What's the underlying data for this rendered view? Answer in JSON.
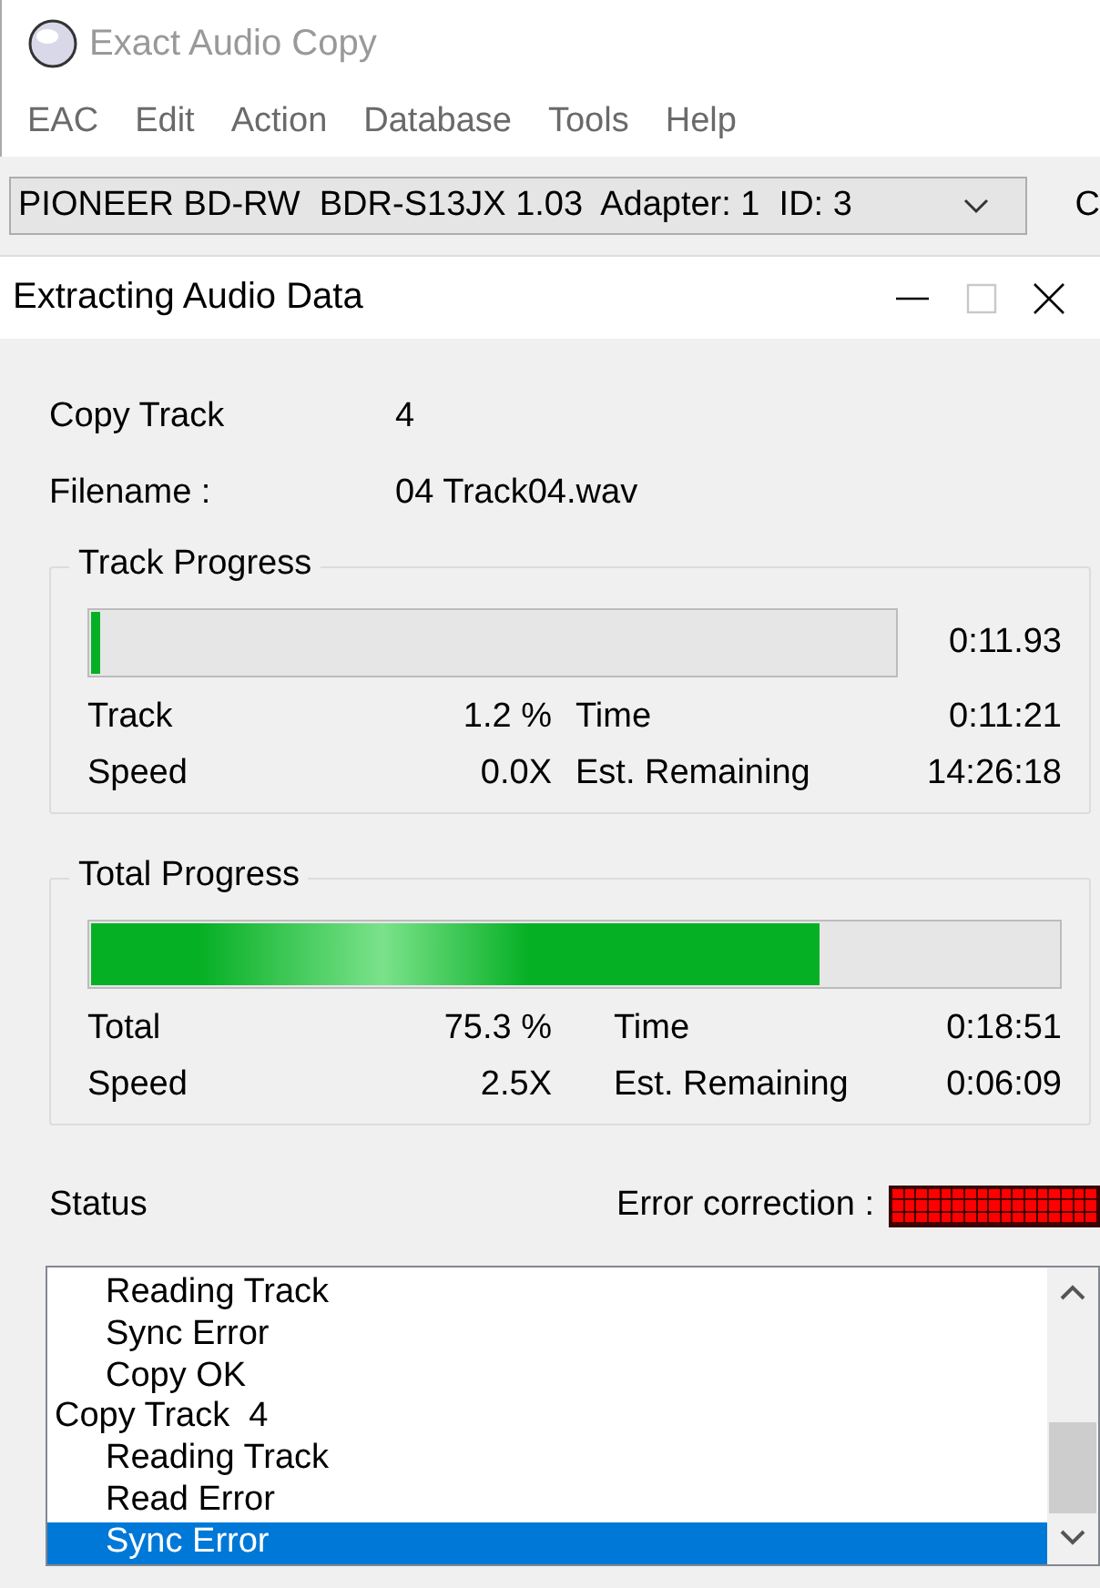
{
  "main_window": {
    "title": "Exact Audio Copy",
    "menu": [
      "EAC",
      "Edit",
      "Action",
      "Database",
      "Tools",
      "Help"
    ],
    "drive": {
      "value": "PIONEER BD-RW  BDR-S13JX 1.03  Adapter: 1  ID: 3"
    },
    "toolbar_cut_text": "C"
  },
  "dialog": {
    "title": "Extracting Audio Data",
    "maximize_disabled": true,
    "fields": [
      {
        "label": "Copy Track",
        "value": "4"
      },
      {
        "label": "Filename :",
        "value": "04 Track04.wav"
      }
    ],
    "groups": [
      {
        "title": "Track Progress",
        "level": 0.012,
        "elapsed": "0:11.93",
        "rows": [
          {
            "label": "Track",
            "value": "1.2 %",
            "label2": "Time",
            "value2": "0:11:21"
          },
          {
            "label": "Speed",
            "value": "0.0X",
            "label2": "Est. Remaining",
            "value2": "14:26:18"
          }
        ]
      },
      {
        "title": "Total Progress",
        "level": 0.753,
        "rows": [
          {
            "label": "Total",
            "value": "75.3 %",
            "label2": "Time",
            "value2": "0:18:51"
          },
          {
            "label": "Speed",
            "value": "2.5X",
            "label2": "Est. Remaining",
            "value2": "0:06:09"
          }
        ]
      }
    ],
    "status": {
      "label": "Status",
      "error_label": "Error correction :",
      "level": 1,
      "log": [
        {
          "children": [
            {
              "text": "Reading Track",
              "selected": false
            },
            {
              "text": "Sync Error",
              "selected": false
            },
            {
              "text": "Copy OK",
              "selected": false
            }
          ]
        },
        {
          "text": "Copy Track  4",
          "selected": false,
          "children": [
            {
              "text": "Reading Track",
              "selected": false
            },
            {
              "text": "Read Error",
              "selected": false
            },
            {
              "text": "Sync Error",
              "selected": true
            }
          ]
        }
      ]
    }
  }
}
